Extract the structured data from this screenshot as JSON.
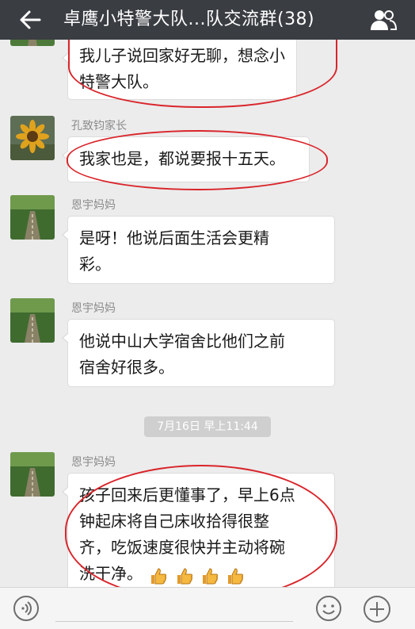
{
  "header": {
    "title": "卓鹰小特警大队...队交流群(38)",
    "back_icon": "back-arrow-icon",
    "group_icon": "group-members-icon"
  },
  "messages": [
    {
      "text": "我儿子说回家好无聊，想念小特警大队。",
      "lines": [
        "我儿子说回家好无聊，想念小",
        "特警大队。"
      ],
      "highlighted": true
    },
    {
      "sender": "孔致钧家长",
      "lines": [
        "我家也是，都说要报十五天。"
      ],
      "highlighted": true,
      "avatar": "sunflower-avatar"
    },
    {
      "sender": "恩宇妈妈",
      "lines": [
        "是呀！他说后面生活会更精",
        "彩。"
      ],
      "highlighted": false,
      "avatar": "road-avatar"
    },
    {
      "sender": "恩宇妈妈",
      "lines": [
        "他说中山大学宿舍比他们之前",
        "宿舍好很多。"
      ],
      "highlighted": false,
      "avatar": "road-avatar"
    },
    {
      "sender": "恩宇妈妈",
      "lines": [
        "孩子回来后更懂事了，早上6点",
        "钟起床将自己床收拾得很整",
        "齐，吃饭速度很快并主动将碗",
        "洗干净。"
      ],
      "highlighted": true,
      "avatar": "road-avatar",
      "emoji": [
        "thumbs-up-icon",
        "thumbs-up-icon",
        "thumbs-up-icon",
        "thumbs-up-icon"
      ]
    }
  ],
  "timestamp": "7月16日 早上11:44",
  "footer": {
    "voice_icon": "voice-input-icon",
    "emoji_icon": "emoji-face-icon",
    "plus_icon": "plus-more-icon"
  },
  "colors": {
    "header_bg": "#3a3d42",
    "chat_bg": "#ececec",
    "highlight_circle": "#d9252b"
  }
}
